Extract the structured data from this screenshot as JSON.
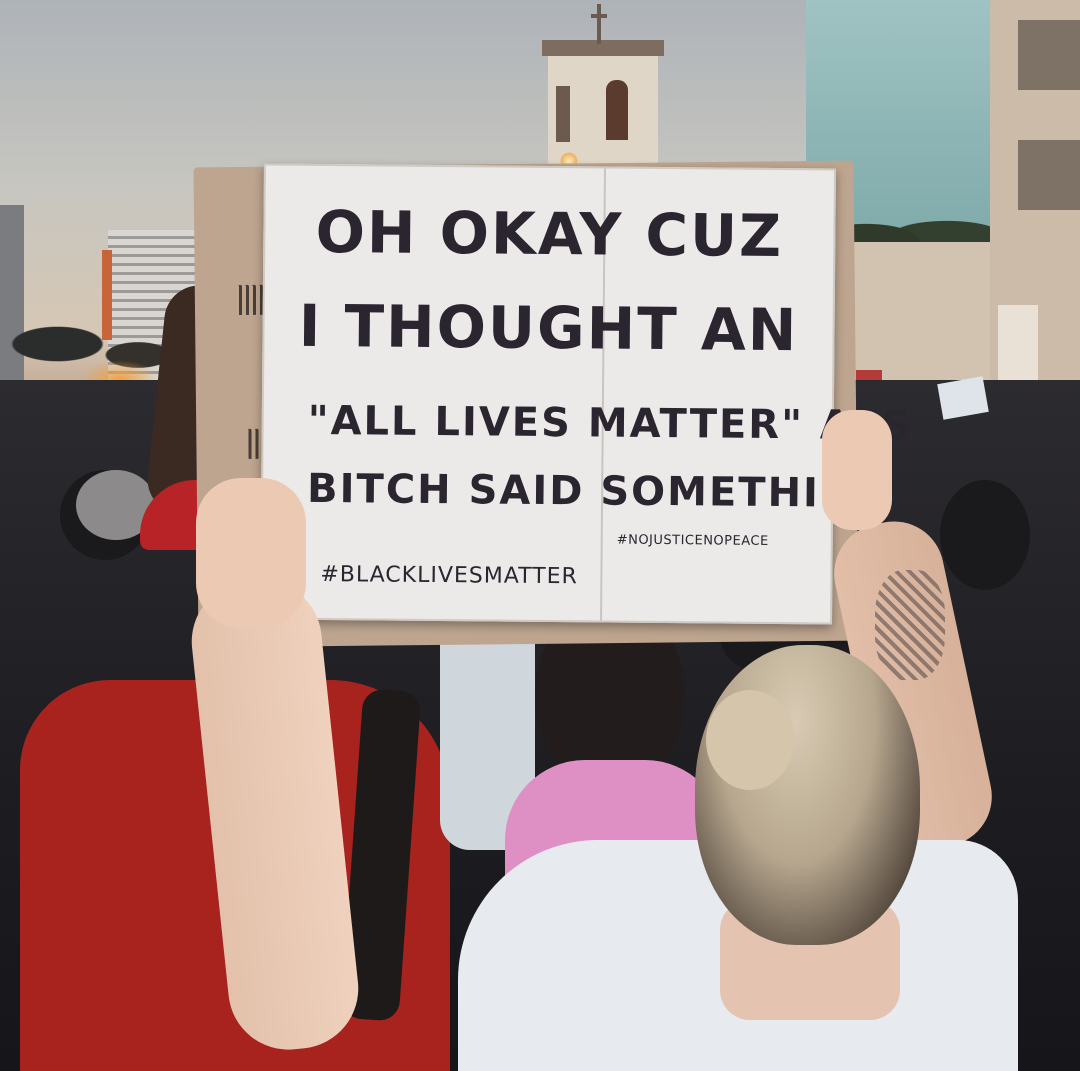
{
  "sign": {
    "line1": "OH OKAY CUZ",
    "line2": "I THOUGHT AN",
    "line3": "\"ALL LIVES MATTER\" ASS",
    "line4": "BITCH SAID SOMETHING",
    "hashtag_left": "#BLACKLIVESMATTER",
    "hashtag_right": "#NOJUSTICENOPEACE"
  },
  "colors": {
    "sign_background": "#eceae8",
    "sign_ink": "#2b2530",
    "cardboard": "#bda58f",
    "sky": "#c7c6c0"
  }
}
